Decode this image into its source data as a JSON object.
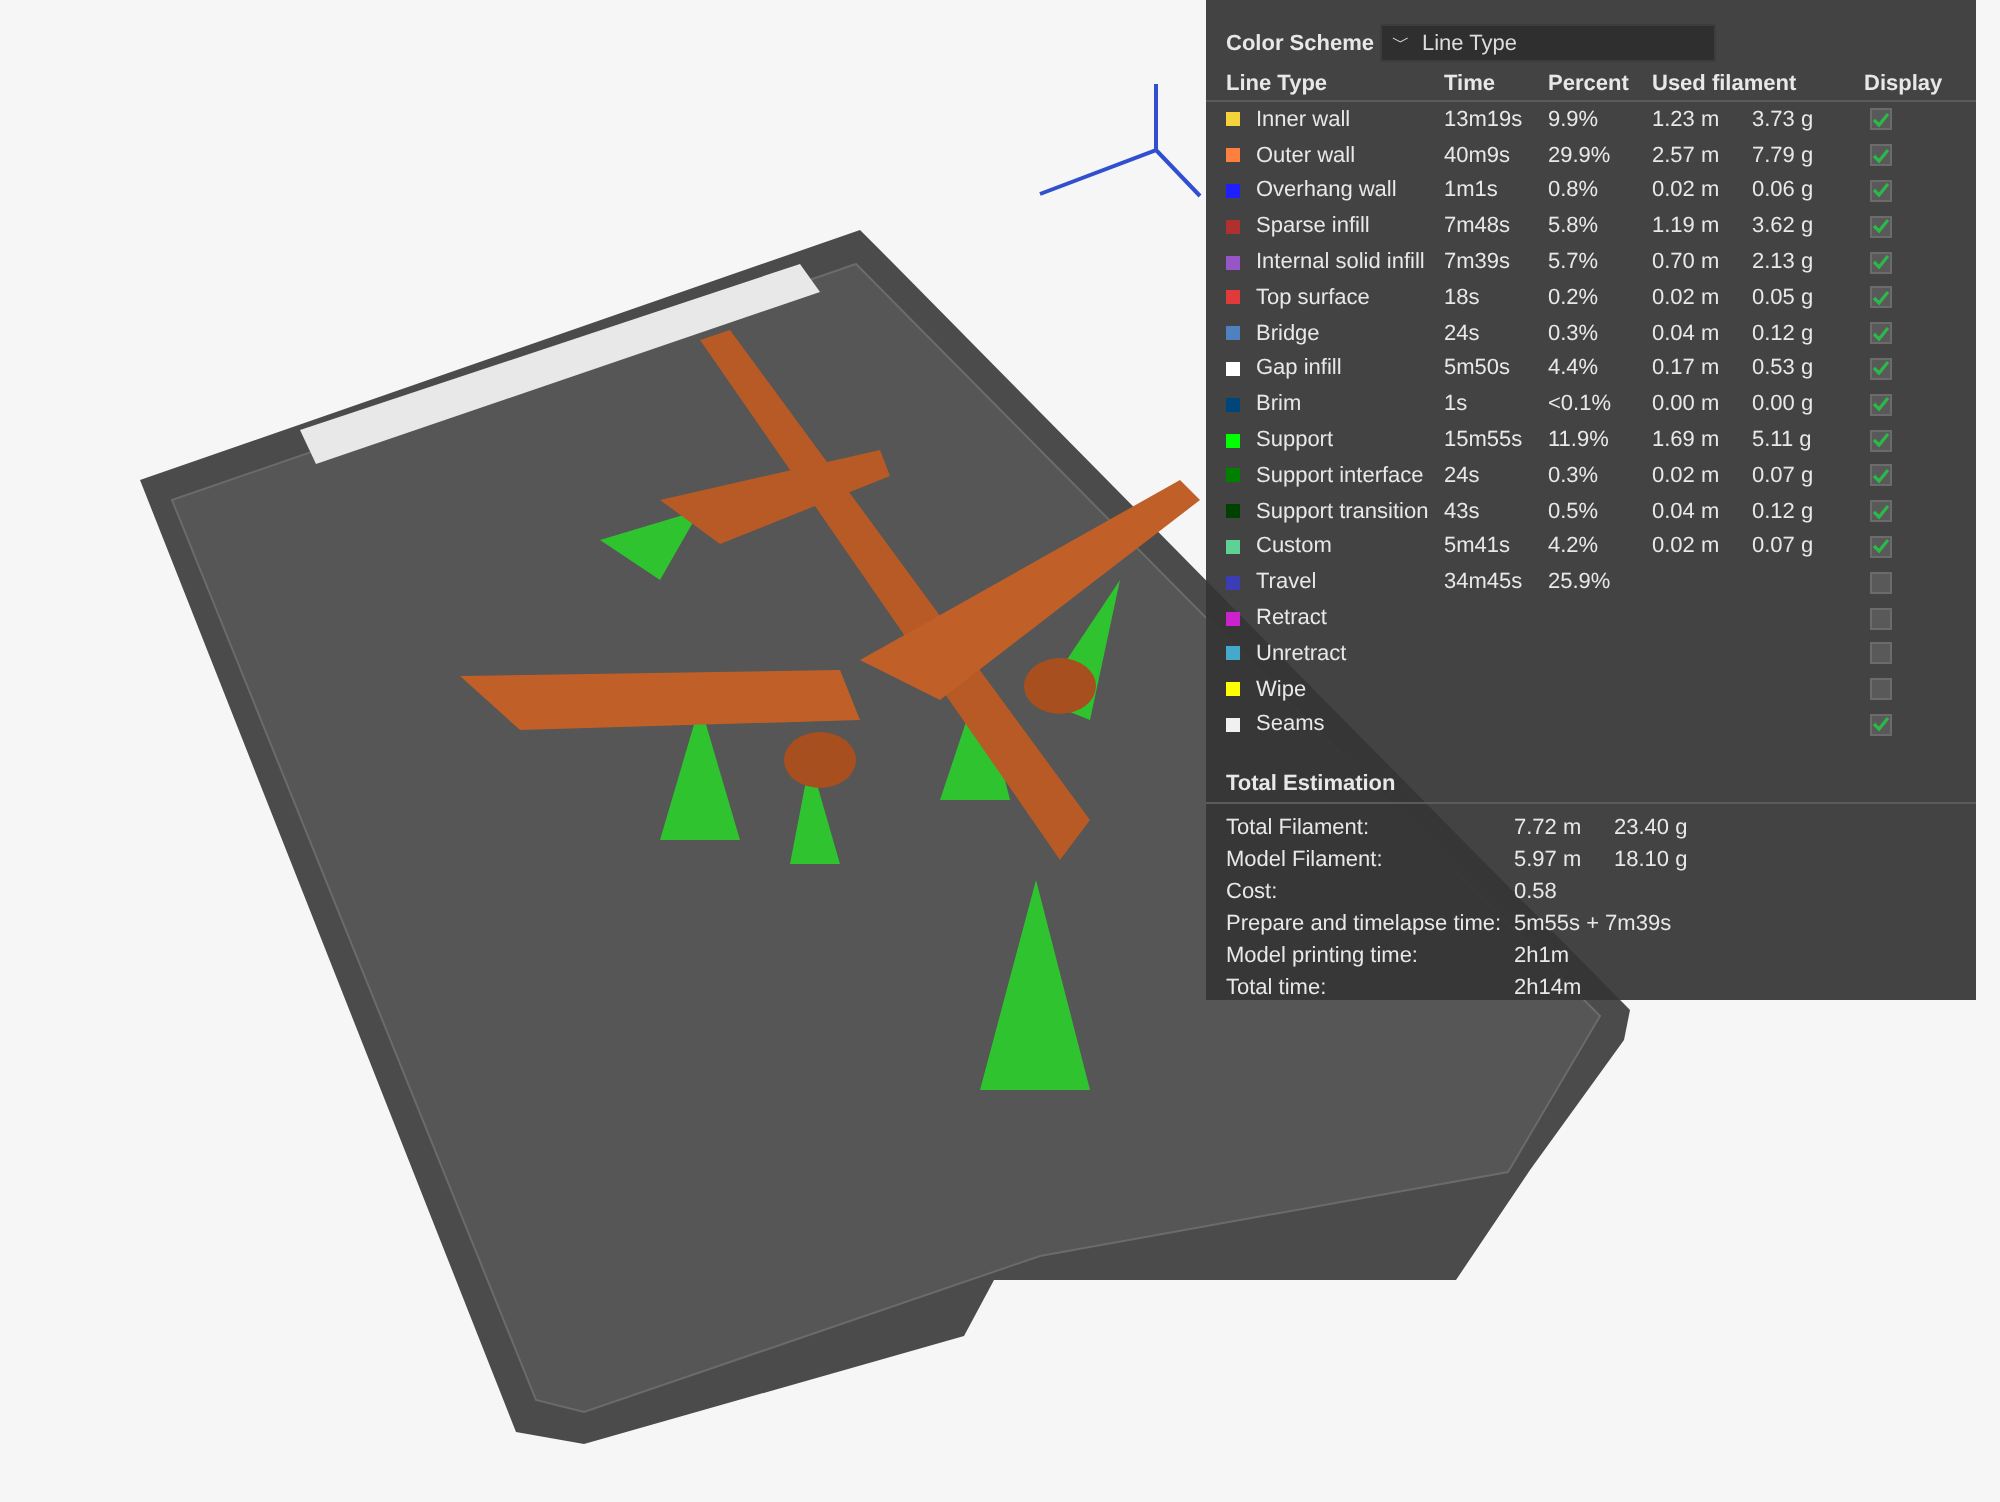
{
  "panel": {
    "color_scheme_label": "Color Scheme",
    "color_scheme": {
      "caret": "﹀",
      "value": "Line Type"
    },
    "columns": [
      "Line Type",
      "Time",
      "Percent",
      "Used filament",
      "Display"
    ],
    "rows": [
      {
        "name": "Inner wall",
        "color": "#f5d33b",
        "time": "13m19s",
        "percent": "9.9%",
        "length": "1.23 m",
        "weight": "3.73 g",
        "display": true
      },
      {
        "name": "Outer wall",
        "color": "#ff7f3f",
        "time": "40m9s",
        "percent": "29.9%",
        "length": "2.57 m",
        "weight": "7.79 g",
        "display": true
      },
      {
        "name": "Overhang wall",
        "color": "#1e1eff",
        "time": "1m1s",
        "percent": "0.8%",
        "length": "0.02 m",
        "weight": "0.06 g",
        "display": true
      },
      {
        "name": "Sparse infill",
        "color": "#b03030",
        "time": "7m48s",
        "percent": "5.8%",
        "length": "1.19 m",
        "weight": "3.62 g",
        "display": true
      },
      {
        "name": "Internal solid infill",
        "color": "#9656c8",
        "time": "7m39s",
        "percent": "5.7%",
        "length": "0.70 m",
        "weight": "2.13 g",
        "display": true
      },
      {
        "name": "Top surface",
        "color": "#e03a3a",
        "time": "18s",
        "percent": "0.2%",
        "length": "0.02 m",
        "weight": "0.05 g",
        "display": true
      },
      {
        "name": "Bridge",
        "color": "#4f80c0",
        "time": "24s",
        "percent": "0.3%",
        "length": "0.04 m",
        "weight": "0.12 g",
        "display": true
      },
      {
        "name": "Gap infill",
        "color": "#ffffff",
        "time": "5m50s",
        "percent": "4.4%",
        "length": "0.17 m",
        "weight": "0.53 g",
        "display": true
      },
      {
        "name": "Brim",
        "color": "#00467a",
        "time": "1s",
        "percent": "<0.1%",
        "length": "0.00 m",
        "weight": "0.00 g",
        "display": true
      },
      {
        "name": "Support",
        "color": "#00ff00",
        "time": "15m55s",
        "percent": "11.9%",
        "length": "1.69 m",
        "weight": "5.11 g",
        "display": true
      },
      {
        "name": "Support interface",
        "color": "#008000",
        "time": "24s",
        "percent": "0.3%",
        "length": "0.02 m",
        "weight": "0.07 g",
        "display": true
      },
      {
        "name": "Support transition",
        "color": "#004000",
        "time": "43s",
        "percent": "0.5%",
        "length": "0.04 m",
        "weight": "0.12 g",
        "display": true
      },
      {
        "name": "Custom",
        "color": "#5ed194",
        "time": "5m41s",
        "percent": "4.2%",
        "length": "0.02 m",
        "weight": "0.07 g",
        "display": true
      },
      {
        "name": "Travel",
        "color": "#3c3cb4",
        "time": "34m45s",
        "percent": "25.9%",
        "display": false
      },
      {
        "name": "Retract",
        "color": "#cc22cc",
        "display": false
      },
      {
        "name": "Unretract",
        "color": "#44aacc",
        "display": false
      },
      {
        "name": "Wipe",
        "color": "#ffff00",
        "display": false
      },
      {
        "name": "Seams",
        "color": "#f0f0f0",
        "display": true
      }
    ],
    "total_title": "Total Estimation",
    "totals": [
      {
        "label": "Total Filament:",
        "values": [
          "7.72 m",
          "23.40 g"
        ]
      },
      {
        "label": "Model Filament:",
        "values": [
          "5.97 m",
          "18.10 g"
        ]
      },
      {
        "label": "Cost:",
        "values": [
          "0.58"
        ]
      },
      {
        "label": "Prepare and timelapse time:",
        "values": [
          "5m55s + 7m39s"
        ]
      },
      {
        "label": "Model printing time:",
        "values": [
          "2h1m"
        ]
      },
      {
        "label": "Total time:",
        "values": [
          "2h14m"
        ]
      }
    ]
  }
}
